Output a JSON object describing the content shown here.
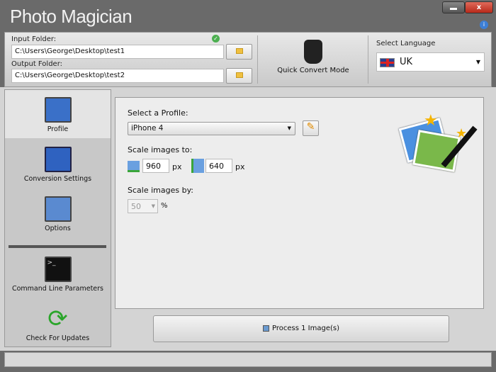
{
  "app": {
    "title": "Photo Magician"
  },
  "window": {
    "minimize": "",
    "close": "x",
    "info": "i"
  },
  "top": {
    "input_label": "Input Folder:",
    "input_value": "C:\\Users\\George\\Desktop\\test1",
    "output_label": "Output Folder:",
    "output_value": "C:\\Users\\George\\Desktop\\test2",
    "quick_convert": "Quick Convert Mode",
    "language_label": "Select Language",
    "language_value": "UK"
  },
  "sidebar": {
    "items": [
      {
        "label": "Profile"
      },
      {
        "label": "Conversion Settings"
      },
      {
        "label": "Options"
      },
      {
        "label": "Command Line Parameters"
      },
      {
        "label": "Check For Updates"
      }
    ]
  },
  "main": {
    "profile_label": "Select a Profile:",
    "profile_value": "iPhone 4",
    "scale_to_label": "Scale images to:",
    "width": "960",
    "height": "640",
    "px": "px",
    "scale_by_label": "Scale images by:",
    "scale_by_value": "50",
    "percent": "%"
  },
  "process_label": "Process 1 Image(s)"
}
